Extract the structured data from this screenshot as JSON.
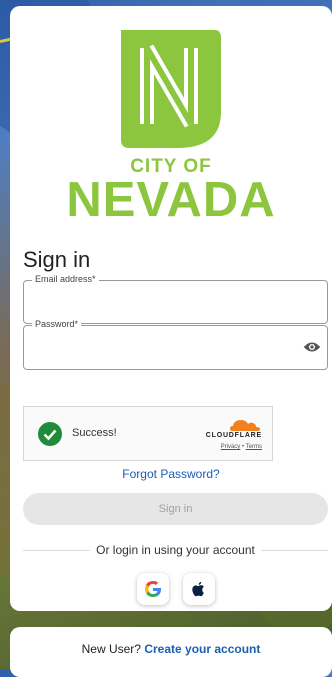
{
  "colors": {
    "brand_green": "#8cc63f",
    "link_blue": "#1a5fb4",
    "success_green": "#1e8c3a",
    "cloudflare_orange": "#f38020"
  },
  "logo": {
    "monogram": "N",
    "city_of": "CITY OF",
    "name": "NEVADA"
  },
  "signin": {
    "title": "Sign in",
    "email_label": "Email address*",
    "email_value": "",
    "password_label": "Password*",
    "password_value": "",
    "password_toggle_icon": "eye-icon"
  },
  "captcha": {
    "status_icon": "check-circle-icon",
    "status_text": "Success!",
    "provider": "CLOUDFLARE",
    "privacy_link": "Privacy",
    "separator": "•",
    "terms_link": "Terms"
  },
  "forgot_password": "Forgot Password?",
  "signin_button": "Sign in",
  "alt_login_text": "Or login in using your account",
  "social": [
    {
      "name": "google",
      "icon": "google-icon"
    },
    {
      "name": "apple",
      "icon": "apple-icon"
    }
  ],
  "footer": {
    "prompt": "New User?",
    "link": "Create your account"
  }
}
